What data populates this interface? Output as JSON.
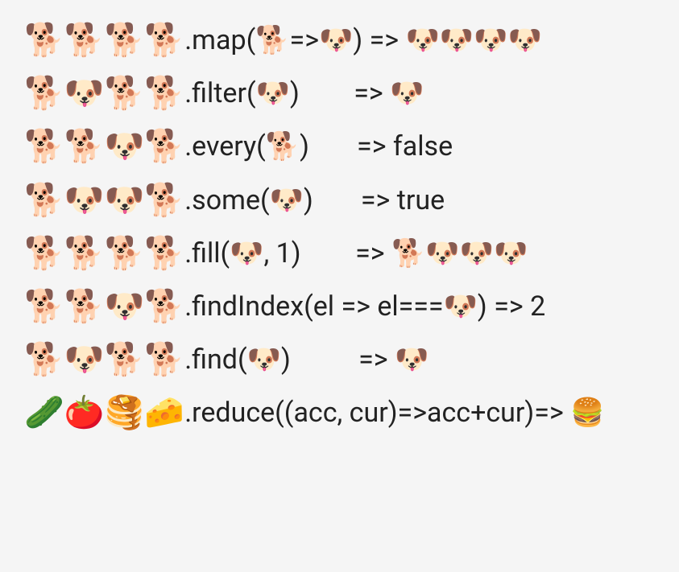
{
  "rows": [
    {
      "arr": "🐕🐕🐕🐕",
      "method": ".map(🐕=>🐶)",
      "pad": " ",
      "arrow": "=>",
      "result": " 🐶🐶🐶🐶"
    },
    {
      "arr": "🐕🐶🐕🐕",
      "method": ".filter(🐶)",
      "pad": "        ",
      "arrow": "=>",
      "result": " 🐶"
    },
    {
      "arr": "🐕🐕🐶🐕",
      "method": ".every(🐕)",
      "pad": "       ",
      "arrow": "=>",
      "result": " false"
    },
    {
      "arr": "🐕🐶🐶🐕",
      "method": ".some(🐶)",
      "pad": "       ",
      "arrow": "=>",
      "result": " true"
    },
    {
      "arr": "🐕🐕🐕🐕",
      "method": ".fill(🐶, 1)",
      "pad": "        ",
      "arrow": "=>",
      "result": " 🐕🐶🐶🐶"
    },
    {
      "arr": "🐕🐕🐶🐕",
      "method": ".findIndex(el => el===🐶)",
      "pad": " ",
      "arrow": "=>",
      "result": " 2"
    },
    {
      "arr": "🐕🐶🐕🐕",
      "method": ".find(🐶)",
      "pad": "          ",
      "arrow": "=>",
      "result": " 🐶"
    },
    {
      "arr": "🥒🍅🥞🧀",
      "method": ".reduce((acc, cur)=>acc+cur)",
      "pad": "",
      "arrow": "=>",
      "result": " 🍔"
    }
  ]
}
